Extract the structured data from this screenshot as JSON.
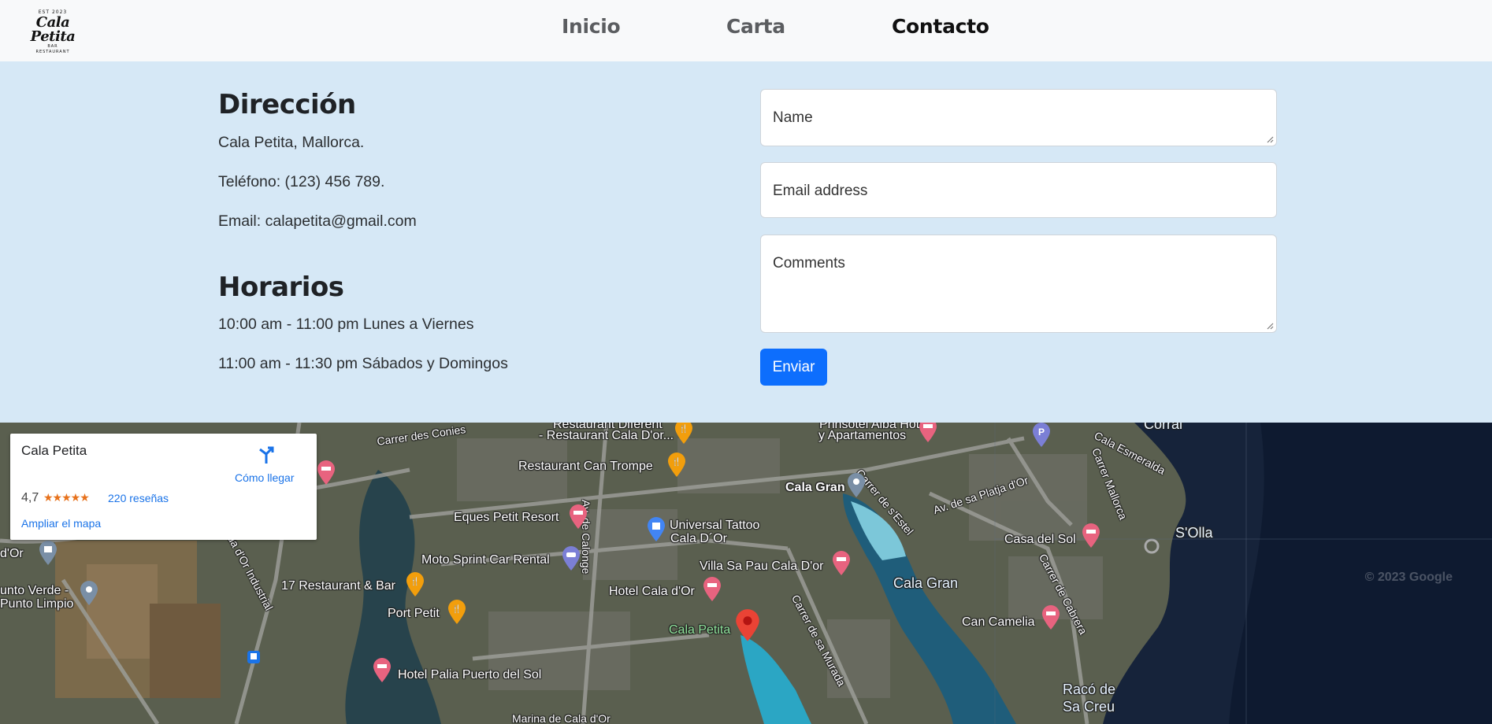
{
  "brand": {
    "logo_name": "Cala Petita",
    "logo_top": "EST 2023",
    "logo_mid": "BAR",
    "logo_bottom": "RESTAURANT"
  },
  "nav": {
    "items": [
      {
        "label": "Inicio"
      },
      {
        "label": "Carta"
      },
      {
        "label": "Contacto"
      }
    ]
  },
  "contact": {
    "address_heading": "Dirección",
    "address": "Cala Petita, Mallorca.",
    "phone": "Teléfono: (123) 456 789.",
    "email": "Email: calapetita@gmail.com",
    "hours_heading": "Horarios",
    "hours_weekdays": "10:00 am - 11:00 pm Lunes a Viernes",
    "hours_weekend": "11:00 am - 11:30 pm Sábados y Domingos"
  },
  "form": {
    "name_placeholder": "Name",
    "email_placeholder": "Email address",
    "comments_placeholder": "Comments",
    "submit_label": "Enviar"
  },
  "map": {
    "place_name": "Cala Petita",
    "rating": "4,7",
    "stars": "★★★★★",
    "reviews": "220 reseñas",
    "directions_label": "Cómo llegar",
    "enlarge_label": "Ampliar el mapa",
    "copyright": "© 2023 Google",
    "labels": {
      "l1": "Restaurant Diferent",
      "l2": "- Restaurant Cala D'or...",
      "l3": "Carrer des Conies",
      "l4": "Restaurant Can Trompe",
      "l5": "Eques Petit Resort",
      "l6": "Universal Tattoo",
      "l7": "Cala D´Or",
      "l8": "Moto Sprint Car Rental",
      "l9": "17 Restaurant & Bar",
      "l10": "Port Petit",
      "l11": "Hotel Cala d'Or",
      "l12": "Villa Sa Pau Cala D'or",
      "l13": "Cala Petita",
      "l14": "Hotel Palia Puerto del Sol",
      "l15": "Prinsotel Alba Hotel",
      "l16": "y Apartamentos",
      "l17": "Cala Gran",
      "l18": "Cala Gran",
      "l19": "Casa del Sol",
      "l20": "S'Olla",
      "l21": "Can Camelia",
      "l22": "Racó de",
      "l23": "Sa Creu",
      "l24": "Corral",
      "l25": "d'Or",
      "l26": "unto Verde -",
      "l27": "Punto Limpio",
      "l28": "Av. de Calonge",
      "l29": "Carrer de s'Estel",
      "l30": "Av. de sa Platja d'Or",
      "l31": "Carrer Mallorca",
      "l32": "Carrer de Cabrera",
      "l33": "Carrer de sa Murada",
      "l34": "Cala Esmeralda",
      "l35": "da d'Or Industrial",
      "l36": "Marina de Cala d'Or"
    }
  }
}
